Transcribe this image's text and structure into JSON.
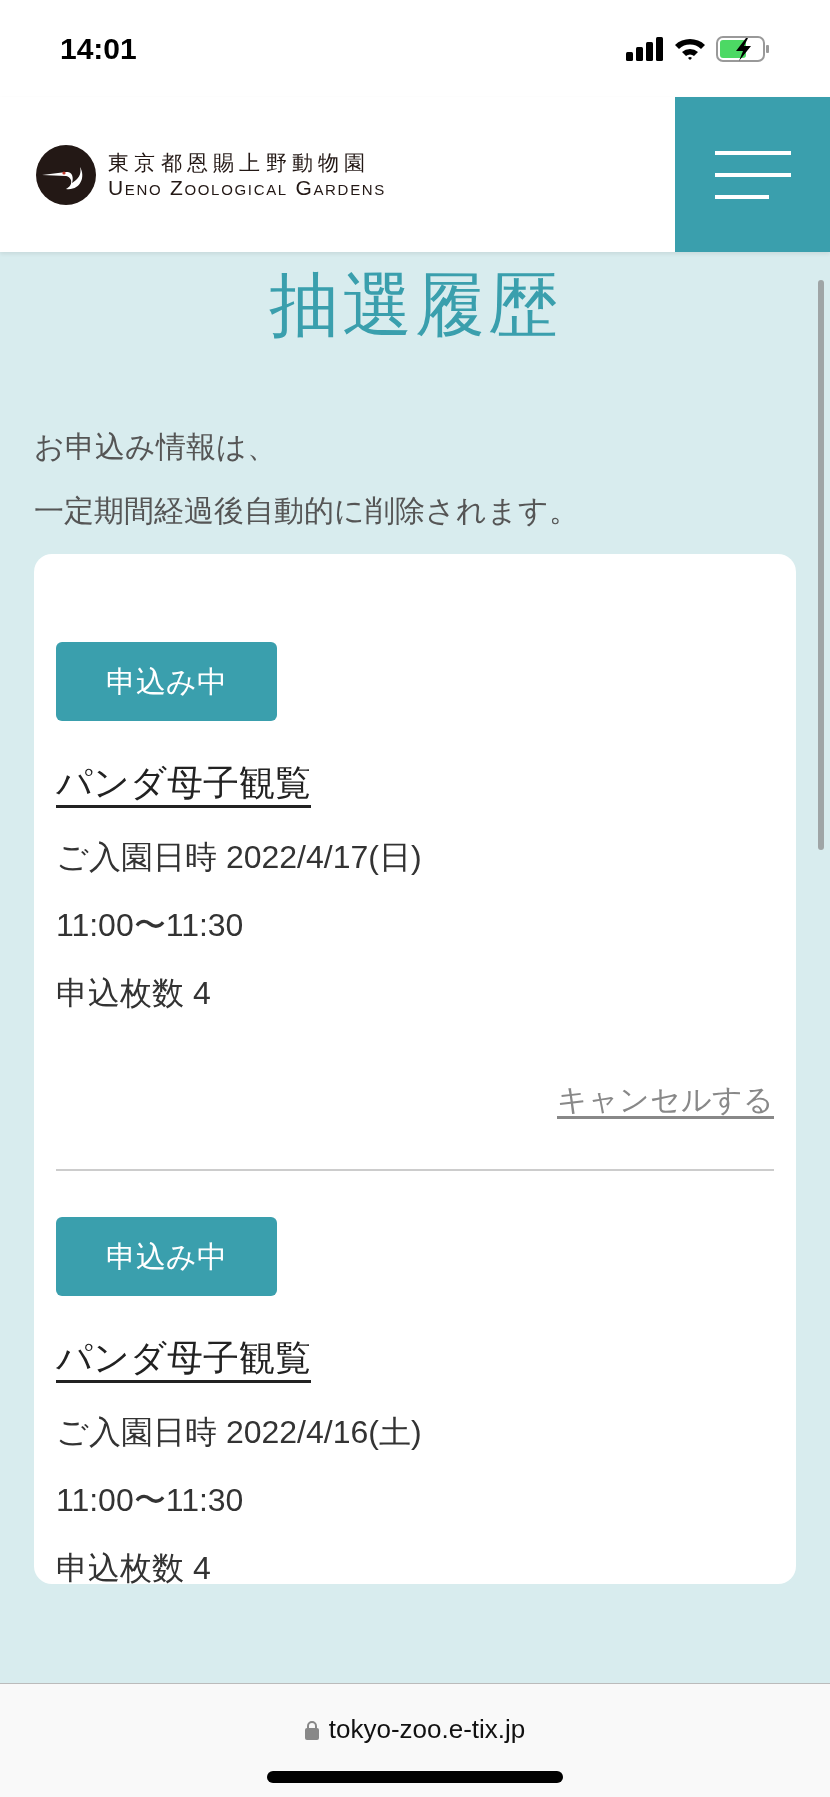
{
  "status_bar": {
    "time": "14:01"
  },
  "header": {
    "logo_ja": "東京都恩賜上野動物園",
    "logo_en": "Ueno Zoological Gardens"
  },
  "page_title": "抽選履歴",
  "notice": [
    "お申込み情報は、",
    "一定期間経過後自動的に削除されます。"
  ],
  "entries": [
    {
      "status": "申込み中",
      "event": "パンダ母子観覧",
      "visit": "ご入園日時 2022/4/17(日)",
      "time": "11:00〜11:30",
      "count": "申込枚数 4",
      "cancel": "キャンセルする"
    },
    {
      "status": "申込み中",
      "event": "パンダ母子観覧",
      "visit": "ご入園日時 2022/4/16(土)",
      "time": "11:00〜11:30",
      "count": "申込枚数 4"
    }
  ],
  "browser_bar": {
    "url": "tokyo-zoo.e-tix.jp"
  }
}
